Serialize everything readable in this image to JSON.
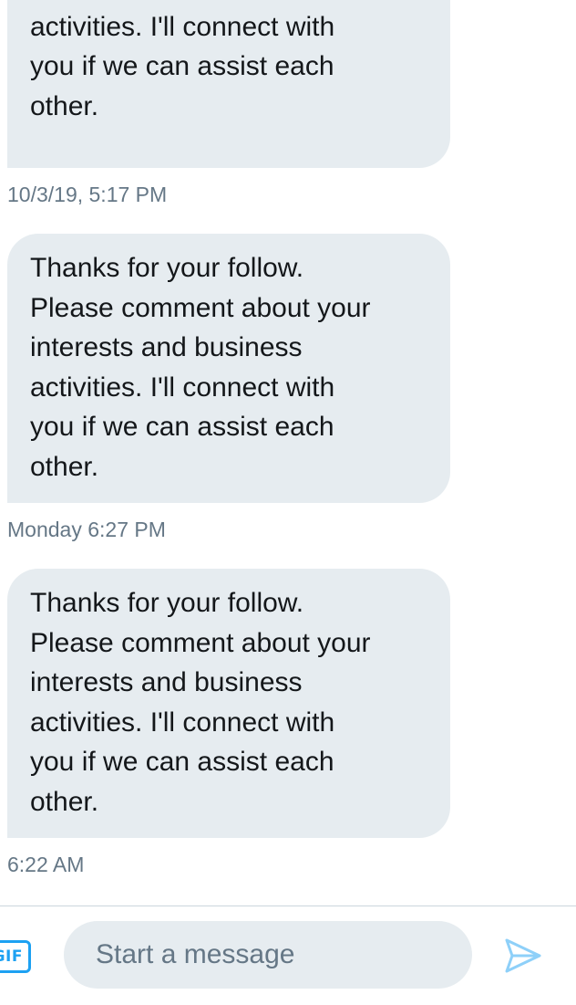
{
  "messages": [
    {
      "text": "interests and business\nactivities. I'll connect with\nyou if we can assist each\nother.",
      "timestamp": "10/3/19, 5:17 PM"
    },
    {
      "text": "Thanks for your follow.\nPlease comment about your\ninterests and business\nactivities. I'll connect with\nyou if we can assist each\nother.",
      "timestamp": "Monday 6:27 PM"
    },
    {
      "text": "Thanks for your follow.\nPlease comment about your\ninterests and business\nactivities. I'll connect with\nyou if we can assist each\nother.",
      "timestamp": "6:22 AM"
    }
  ],
  "composer": {
    "gif_label": "GIF",
    "placeholder": "Start a message",
    "send_icon": "send-icon"
  },
  "colors": {
    "bubble_background": "#e6ecf0",
    "text": "#14171a",
    "timestamp": "#657786",
    "accent": "#1da1f2",
    "send_icon_disabled": "#8ed0f9"
  }
}
